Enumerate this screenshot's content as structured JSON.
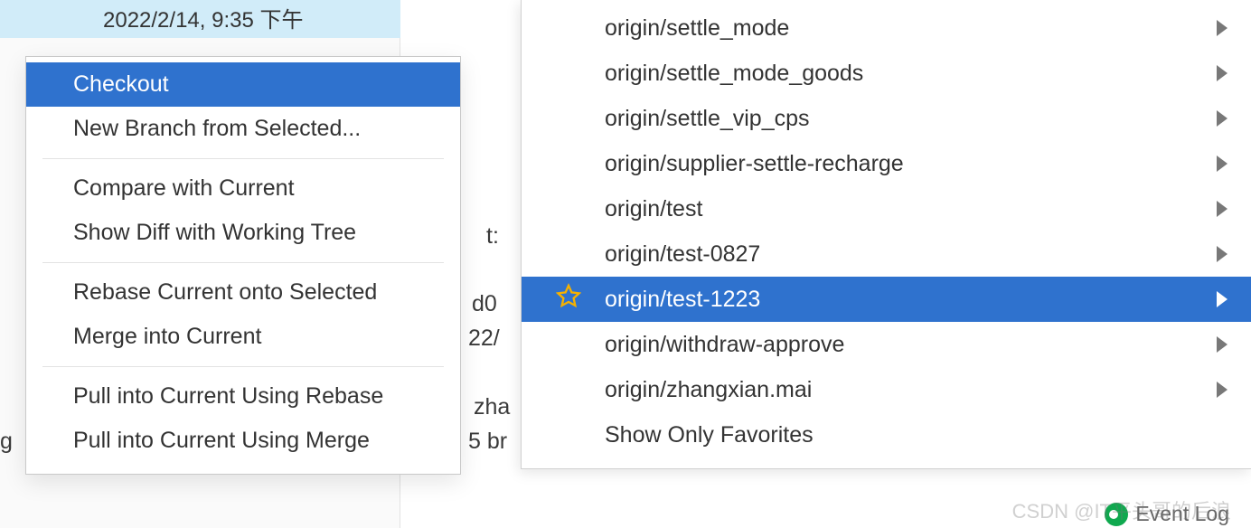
{
  "timestamp": "2022/2/14, 9:35 下午",
  "context_menu": {
    "groups": [
      [
        {
          "label": "Checkout",
          "selected": true
        },
        {
          "label": "New Branch from Selected...",
          "selected": false
        }
      ],
      [
        {
          "label": "Compare with Current",
          "selected": false
        },
        {
          "label": "Show Diff with Working Tree",
          "selected": false
        }
      ],
      [
        {
          "label": "Rebase Current onto Selected",
          "selected": false
        },
        {
          "label": "Merge into Current",
          "selected": false
        }
      ],
      [
        {
          "label": "Pull into Current Using Rebase",
          "selected": false
        },
        {
          "label": "Pull into Current Using Merge",
          "selected": false
        }
      ]
    ]
  },
  "branch_menu": {
    "items": [
      {
        "label": "origin/settle_mode",
        "has_submenu": true,
        "selected": false,
        "favorite": false
      },
      {
        "label": "origin/settle_mode_goods",
        "has_submenu": true,
        "selected": false,
        "favorite": false
      },
      {
        "label": "origin/settle_vip_cps",
        "has_submenu": true,
        "selected": false,
        "favorite": false
      },
      {
        "label": "origin/supplier-settle-recharge",
        "has_submenu": true,
        "selected": false,
        "favorite": false
      },
      {
        "label": "origin/test",
        "has_submenu": true,
        "selected": false,
        "favorite": false
      },
      {
        "label": "origin/test-0827",
        "has_submenu": true,
        "selected": false,
        "favorite": false
      },
      {
        "label": "origin/test-1223",
        "has_submenu": true,
        "selected": true,
        "favorite": true
      },
      {
        "label": "origin/withdraw-approve",
        "has_submenu": true,
        "selected": false,
        "favorite": false
      },
      {
        "label": "origin/zhangxian.mai",
        "has_submenu": true,
        "selected": false,
        "favorite": false
      },
      {
        "label": "Show Only Favorites",
        "has_submenu": false,
        "selected": false,
        "favorite": false
      }
    ]
  },
  "background_fragments": {
    "frag1": "g",
    "frag2": "t:",
    "frag3": "d0",
    "frag4": "22/",
    "frag5": "zha",
    "frag6": "5 br"
  },
  "footer": {
    "event_log_label": "Event Log"
  },
  "watermark": "CSDN @IT平头哥的后浪"
}
